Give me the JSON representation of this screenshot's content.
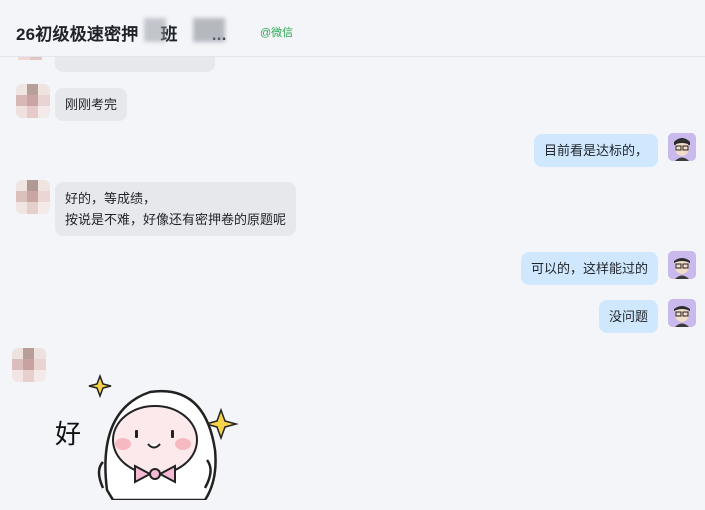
{
  "header": {
    "title": "26初级极速密押",
    "title_tail": "班",
    "title_ellipsis": "...",
    "source_tag": "@微信"
  },
  "messages": [
    {
      "side": "left",
      "text": "刚刚考完"
    },
    {
      "side": "right",
      "text": "目前看是达标的，"
    },
    {
      "side": "left",
      "line1": "好的，等成绩，",
      "line2": "按说是不难，好像还有密押卷的原题呢"
    },
    {
      "side": "right",
      "text": "可以的，这样能过的"
    },
    {
      "side": "right",
      "text": "没问题"
    }
  ],
  "sticker": {
    "text": "好"
  },
  "colors": {
    "bg": "#f4f5f9",
    "left_bubble": "#e6e8ec",
    "right_bubble": "#cfe8fe",
    "tag_green": "#2aa852"
  }
}
